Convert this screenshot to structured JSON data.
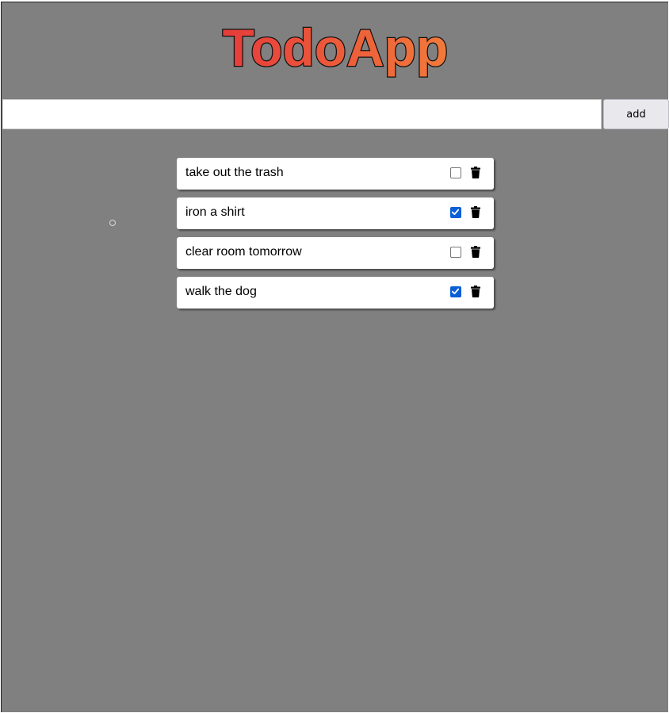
{
  "app": {
    "title": "TodoApp",
    "title_gradient": [
      "#e63b3b",
      "#f27a3a"
    ]
  },
  "input": {
    "value": "",
    "placeholder": ""
  },
  "add_button": {
    "label": "add"
  },
  "todos": [
    {
      "text": "take out the trash",
      "done": false
    },
    {
      "text": "iron a shirt",
      "done": true
    },
    {
      "text": "clear room tomorrow",
      "done": false
    },
    {
      "text": "walk the dog",
      "done": true
    }
  ],
  "colors": {
    "background": "#808080",
    "checkbox_accent": "#0b5fd6"
  },
  "icons": {
    "delete": "trash-icon"
  }
}
